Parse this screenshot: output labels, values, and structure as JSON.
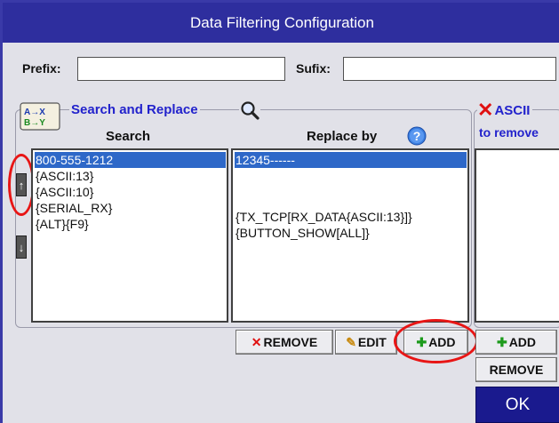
{
  "window": {
    "title": "Data Filtering Configuration"
  },
  "prefix": {
    "label": "Prefix:",
    "value": ""
  },
  "suffix": {
    "label": "Sufix:",
    "value": ""
  },
  "search_replace": {
    "title": "Search and Replace",
    "search_header": "Search",
    "replace_header": "Replace by",
    "search_items": [
      "800-555-1212",
      "{ASCII:13}",
      "{ASCII:10}",
      "{SERIAL_RX}",
      "{ALT}{F9}"
    ],
    "replace_items": [
      "12345------",
      "",
      "",
      "{TX_TCP[RX_DATA{ASCII:13}]}",
      "{BUTTON_SHOW[ALL]}"
    ],
    "buttons": {
      "remove": "REMOVE",
      "edit": "EDIT",
      "add": "ADD"
    }
  },
  "ascii": {
    "title": "ASCII",
    "subtitle": "to remove",
    "buttons": {
      "add": "ADD",
      "remove": "REMOVE"
    }
  },
  "ok_label": "OK",
  "icons": {
    "search_replace": "a-to-x-b-to-y-icon",
    "magnifier": "magnifier-icon",
    "help": "help-icon",
    "move_up": "arrow-up-icon",
    "move_down": "arrow-down-icon",
    "ascii_x": "red-x-icon"
  },
  "colors": {
    "titlebar": "#2e2e9e",
    "selection": "#2e68c8",
    "accent_blue": "#2222cc",
    "annotation_red": "#e81515"
  }
}
